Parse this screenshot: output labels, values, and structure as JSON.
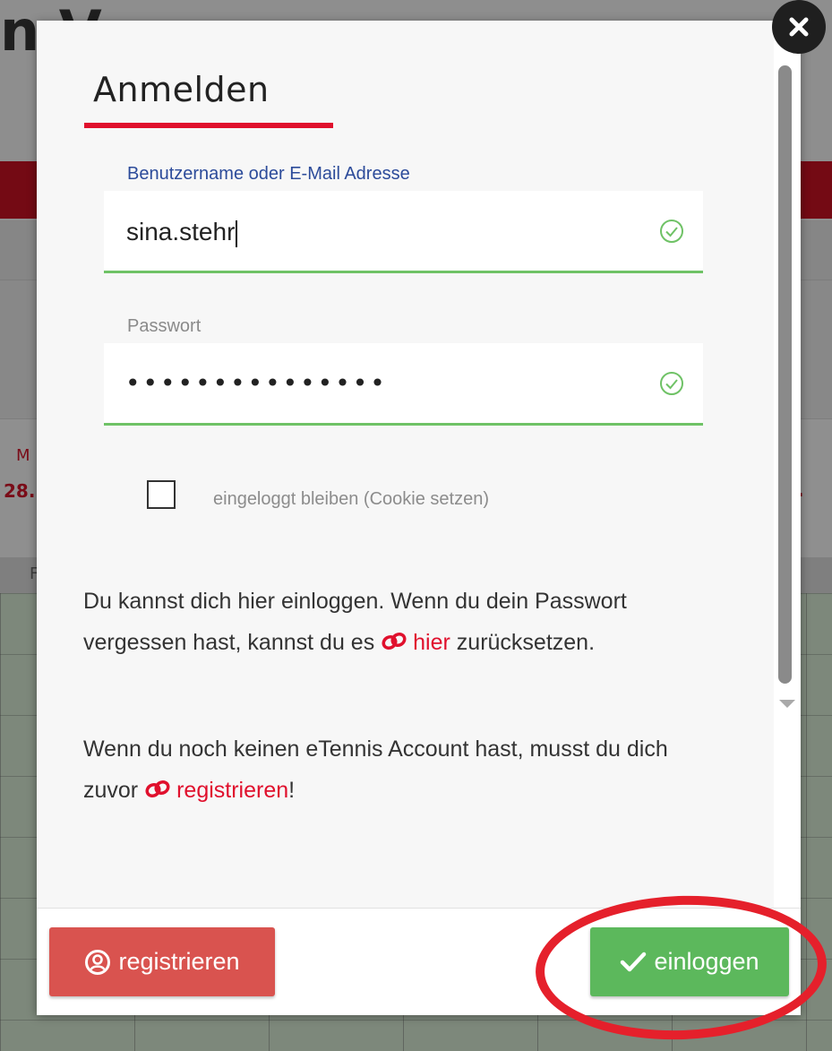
{
  "background": {
    "title_partial": "n  V",
    "red_text_1": "M",
    "red_text_2": "28.",
    "red_text_3": "·",
    "header_letter": "F"
  },
  "modal": {
    "title": "Anmelden",
    "username": {
      "label": "Benutzername oder E-Mail Adresse",
      "value": "sina.stehr"
    },
    "password": {
      "label": "Passwort",
      "masked_value": "•••••••••••••••"
    },
    "remember_me": {
      "label": "eingeloggt bleiben (Cookie setzen)",
      "checked": false
    },
    "info_paragraph_1": {
      "before_link": "Du kannst dich hier einloggen. Wenn du dein Passwort vergessen hast, kannst du es ",
      "link_text": "hier",
      "after_link": " zurücksetzen."
    },
    "info_paragraph_2": {
      "before_link": "Wenn du noch keinen eTennis Account hast, musst du dich zuvor ",
      "link_text": "registrieren",
      "after_link": "!"
    },
    "footer": {
      "register_label": "registrieren",
      "login_label": "einloggen"
    }
  },
  "icons": {
    "close": "close-icon",
    "valid": "check-circle-icon",
    "link": "link-icon",
    "user": "user-circle-icon",
    "check": "checkmark-icon"
  },
  "colors": {
    "accent_red": "#e0102d",
    "success_green": "#5cb85c",
    "danger_red": "#d9534f",
    "label_blue": "#2c4b9a",
    "annotation_red": "#e5202b"
  }
}
